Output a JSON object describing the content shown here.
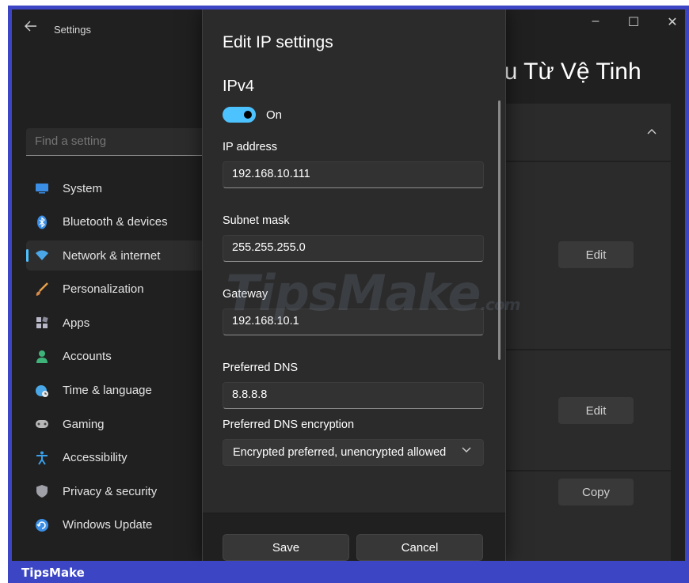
{
  "window": {
    "title": "Settings",
    "back_icon": "arrow-left-icon",
    "controls": {
      "minimize": "–",
      "maximize": "☐",
      "close": "✕"
    }
  },
  "search": {
    "placeholder": "Find a setting"
  },
  "sidebar": {
    "items": [
      {
        "label": "System",
        "icon": "monitor-icon",
        "color": "#3a8ee6"
      },
      {
        "label": "Bluetooth & devices",
        "icon": "bluetooth-icon",
        "color": "#3a8ee6"
      },
      {
        "label": "Network & internet",
        "icon": "wifi-icon",
        "color": "#4aa8e8",
        "active": true
      },
      {
        "label": "Personalization",
        "icon": "paintbrush-icon",
        "color": "#e8a24a"
      },
      {
        "label": "Apps",
        "icon": "apps-icon",
        "color": "#b8b8c8"
      },
      {
        "label": "Accounts",
        "icon": "person-icon",
        "color": "#3fb47a"
      },
      {
        "label": "Time & language",
        "icon": "globe-clock-icon",
        "color": "#4aa8e8"
      },
      {
        "label": "Gaming",
        "icon": "gamepad-icon",
        "color": "#b8b8b8"
      },
      {
        "label": "Accessibility",
        "icon": "accessibility-icon",
        "color": "#3aa0e8"
      },
      {
        "label": "Privacy & security",
        "icon": "shield-icon",
        "color": "#a0a0a8"
      },
      {
        "label": "Windows Update",
        "icon": "refresh-icon",
        "color": "#3a8ee6"
      }
    ]
  },
  "main": {
    "title_fragment": "ệu Từ Vệ Tinh",
    "buttons": [
      "Edit",
      "Edit",
      "Copy"
    ]
  },
  "dialog": {
    "title": "Edit IP settings",
    "section": "IPv4",
    "toggle_state": "On",
    "fields": {
      "ip_label": "IP address",
      "ip_value": "192.168.10.111",
      "subnet_label": "Subnet mask",
      "subnet_value": "255.255.255.0",
      "gateway_label": "Gateway",
      "gateway_value": "192.168.10.1",
      "dns_label": "Preferred DNS",
      "dns_value": "8.8.8.8",
      "dns_enc_label": "Preferred DNS encryption",
      "dns_enc_value": "Encrypted preferred, unencrypted allowed"
    },
    "save_label": "Save",
    "cancel_label": "Cancel"
  },
  "watermark": {
    "text": "TipsMake",
    "suffix": ".com"
  },
  "brand": {
    "label": "TipsMake"
  },
  "colors": {
    "accent": "#4cc2ff",
    "frame": "#3c46c4",
    "bg": "#202020",
    "dialog": "#2b2b2b"
  }
}
